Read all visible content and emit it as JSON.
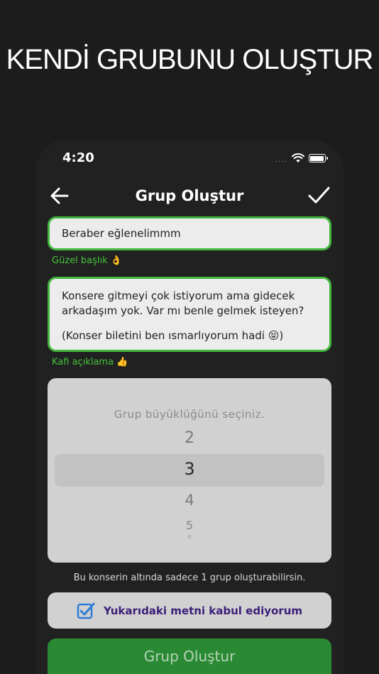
{
  "promo": {
    "headline": "KENDİ GRUBUNU OLUŞTUR"
  },
  "status_bar": {
    "time": "4:20",
    "signal": "....",
    "icons": [
      "wifi-icon",
      "battery-icon"
    ]
  },
  "nav": {
    "title": "Grup Oluştur",
    "back_icon": "arrow-left-icon",
    "confirm_icon": "checkmark-icon"
  },
  "form": {
    "title_value": "Beraber eğlenelimmm",
    "title_hint": "Güzel başlık 👌",
    "description_line1": "Konsere gitmeyi çok istiyorum ama gidecek",
    "description_line2": "arkadaşım yok. Var mı benle gelmek isteyen?",
    "description_line3": "(Konser biletini ben ısmarlıyorum hadi 😝)",
    "description_hint": "Kafi açıklama 👍"
  },
  "picker": {
    "title": "Grup büyüklüğünü seçiniz.",
    "options": [
      "2",
      "3",
      "4",
      "5",
      "6"
    ],
    "selected": "3"
  },
  "info_text": "Bu konserin altında sadece 1 grup oluşturabilirsin.",
  "accept": {
    "label": "Yukarıdaki metni kabul ediyorum",
    "checked": true,
    "icon": "checkbox-checked-icon"
  },
  "submit": {
    "label": "Grup Oluştur"
  },
  "colors": {
    "background": "#1c1c1c",
    "field_border": "#43b53e",
    "hint_text": "#45c43a",
    "accept_text": "#3b1f78",
    "checkbox": "#2e7dd6",
    "button": "#2a8a34"
  }
}
